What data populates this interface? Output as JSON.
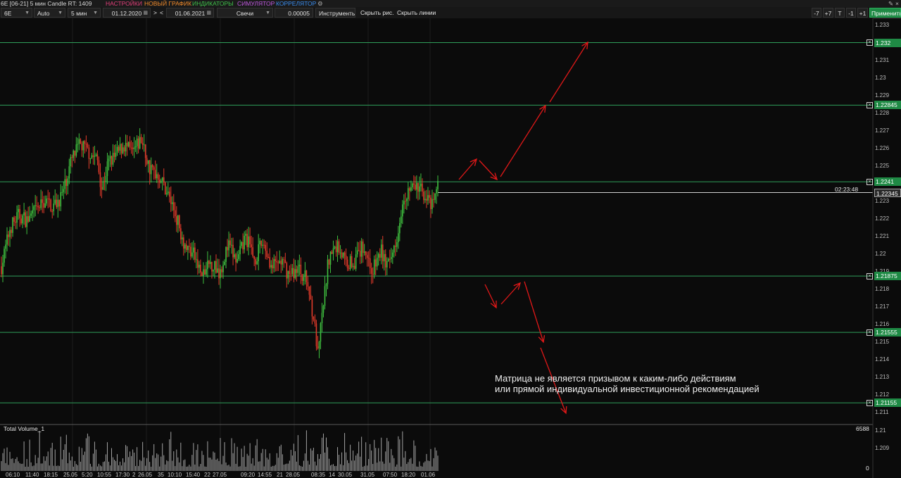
{
  "titlebar": {
    "symbol_info": "6E [06-21] 5 мин Candle RT: 1409",
    "menu": [
      {
        "label": "НАСТРОЙКИ",
        "color": "#e0407a"
      },
      {
        "label": "НОВЫЙ ГРАФИК",
        "color": "#f08a2a"
      },
      {
        "label": "ИНДИКАТОРЫ",
        "color": "#3fc04a"
      },
      {
        "label": "СИМУЛЯТОР",
        "color": "#c05ae0"
      },
      {
        "label": "КОРРЕЛЯТОР",
        "color": "#3a8ef0"
      }
    ]
  },
  "toolbar": {
    "symbol": "6E",
    "mode": "Auto",
    "timeframe": "5 мин",
    "date_from": "01.12.2020",
    "nav_next": ">",
    "nav_prev": "<",
    "date_to": "01.06.2021",
    "chart_type": "Свечи",
    "tick_size": "0.00005",
    "instruments": "Инструменты",
    "hide_drawings": "Скрыть рис.",
    "hide_lines": "Скрыть линии",
    "btn_minus7": "-7",
    "btn_plus7": "+7",
    "btn_t": "T",
    "btn_minus1": "-1",
    "btn_plus1": "+1",
    "apply": "Применить"
  },
  "colors": {
    "level_line": "#2f9e5a",
    "level_label": "#1f8a45",
    "arrow": "#e01818",
    "candle_up": "#3fc03f",
    "candle_down": "#e03a2a",
    "volume": "#bdbdbd"
  },
  "chart_data": {
    "type": "candlestick",
    "price_axis_ticks": [
      "1.233",
      "1.232",
      "1.231",
      "1.23",
      "1.229",
      "1.228",
      "1.227",
      "1.226",
      "1.225",
      "1.224",
      "1.223",
      "1.222",
      "1.221",
      "1.22",
      "1.219",
      "1.218",
      "1.217",
      "1.216",
      "1.215",
      "1.214",
      "1.213",
      "1.212",
      "1.211",
      "1.21",
      "1.209"
    ],
    "ylim": [
      1.2108,
      1.2333
    ],
    "levels": [
      {
        "price": 1.232,
        "label": "1.232"
      },
      {
        "price": 1.22845,
        "label": "1.22845"
      },
      {
        "price": 1.2241,
        "label": "1.2241"
      },
      {
        "price": 1.21875,
        "label": "1.21875"
      },
      {
        "price": 1.21555,
        "label": "1.21555"
      },
      {
        "price": 1.21155,
        "label": "1.21155"
      }
    ],
    "current_price": {
      "label": "1.22345",
      "timer": "02:23:48"
    },
    "price_path": [
      [
        0,
        1.2193
      ],
      [
        0.02,
        1.2215
      ],
      [
        0.04,
        1.2222
      ],
      [
        0.06,
        1.2219
      ],
      [
        0.08,
        1.2225
      ],
      [
        0.1,
        1.223
      ],
      [
        0.12,
        1.2227
      ],
      [
        0.14,
        1.2234
      ],
      [
        0.16,
        1.2253
      ],
      [
        0.18,
        1.2262
      ],
      [
        0.2,
        1.2258
      ],
      [
        0.22,
        1.2253
      ],
      [
        0.23,
        1.2237
      ],
      [
        0.245,
        1.2252
      ],
      [
        0.26,
        1.2255
      ],
      [
        0.28,
        1.2262
      ],
      [
        0.3,
        1.2257
      ],
      [
        0.32,
        1.2265
      ],
      [
        0.34,
        1.2248
      ],
      [
        0.36,
        1.2245
      ],
      [
        0.38,
        1.2235
      ],
      [
        0.4,
        1.2222
      ],
      [
        0.42,
        1.2205
      ],
      [
        0.44,
        1.22
      ],
      [
        0.46,
        1.2187
      ],
      [
        0.48,
        1.2195
      ],
      [
        0.5,
        1.219
      ],
      [
        0.52,
        1.2205
      ],
      [
        0.54,
        1.2195
      ],
      [
        0.56,
        1.221
      ],
      [
        0.58,
        1.2197
      ],
      [
        0.6,
        1.2207
      ],
      [
        0.62,
        1.2192
      ],
      [
        0.64,
        1.2196
      ],
      [
        0.66,
        1.2188
      ],
      [
        0.68,
        1.2192
      ],
      [
        0.7,
        1.2185
      ],
      [
        0.715,
        1.2165
      ],
      [
        0.725,
        1.2142
      ],
      [
        0.735,
        1.2165
      ],
      [
        0.75,
        1.2198
      ],
      [
        0.77,
        1.2205
      ],
      [
        0.79,
        1.2195
      ],
      [
        0.81,
        1.2196
      ],
      [
        0.83,
        1.2205
      ],
      [
        0.85,
        1.219
      ],
      [
        0.87,
        1.2202
      ],
      [
        0.88,
        1.2195
      ],
      [
        0.89,
        1.2193
      ],
      [
        0.9,
        1.2205
      ],
      [
        0.91,
        1.2215
      ],
      [
        0.92,
        1.2233
      ],
      [
        0.94,
        1.2238
      ],
      [
        0.96,
        1.2237
      ],
      [
        0.975,
        1.2232
      ],
      [
        0.985,
        1.2225
      ],
      [
        1.0,
        1.2239
      ]
    ],
    "volume_panel": {
      "title": "Total Volume_1",
      "max_label": "6588",
      "min_label": "0"
    },
    "x_tick_labels": [
      "06:10",
      "11:40",
      "18:15",
      "25.05",
      "5:20",
      "10:55",
      "17:30",
      "2",
      "26.05",
      "35",
      "10:10",
      "15:40",
      "22",
      "27.05",
      "09:20",
      "14:55",
      "21",
      "28.05",
      "08:35",
      "14",
      "30.05",
      "31.05",
      "07:50",
      "18:20",
      "01.06"
    ],
    "forecast_arrows": [
      "up scenario from 1.2241 to 1.232",
      "down scenario from 1.21875 to 1.21155"
    ]
  },
  "disclaimer": {
    "line1": "Матрица не является призывом к каким-либо действиям",
    "line2": "или прямой индивидуальной инвестиционной рекомендацией"
  }
}
